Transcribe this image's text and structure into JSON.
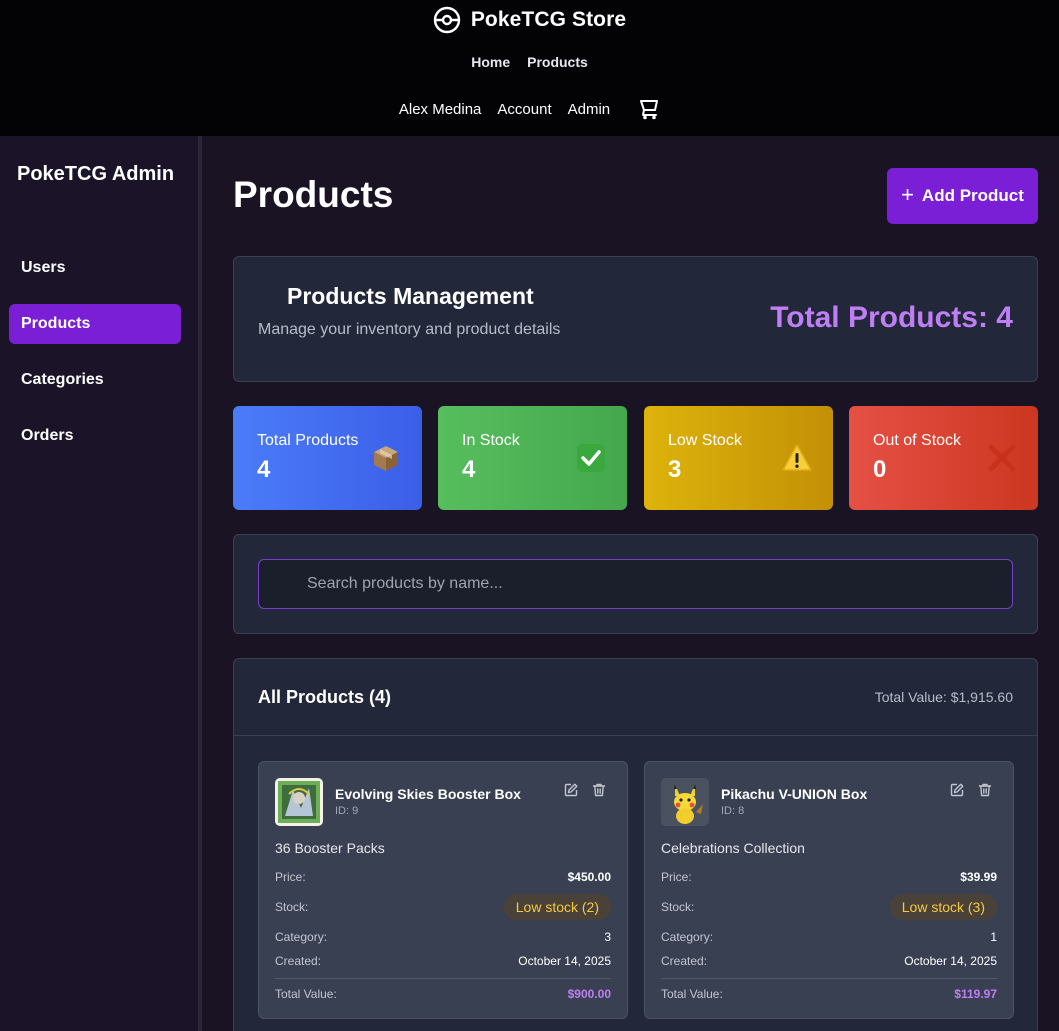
{
  "header": {
    "brand": "PokeTCG Store",
    "nav_primary": [
      "Home",
      "Products"
    ],
    "user_name": "Alex Medina",
    "account": "Account",
    "admin": "Admin"
  },
  "sidebar": {
    "title": "PokeTCG Admin",
    "items": [
      {
        "label": "Users",
        "active": false
      },
      {
        "label": "Products",
        "active": true
      },
      {
        "label": "Categories",
        "active": false
      },
      {
        "label": "Orders",
        "active": false
      }
    ]
  },
  "page": {
    "title": "Products",
    "add_button": "Add Product"
  },
  "management": {
    "title": "Products Management",
    "subtitle": "Manage your inventory and product details",
    "total": "Total Products: 4"
  },
  "stats": [
    {
      "label": "Total Products",
      "value": "4",
      "icon": "package-icon"
    },
    {
      "label": "In Stock",
      "value": "4",
      "icon": "check-icon"
    },
    {
      "label": "Low Stock",
      "value": "3",
      "icon": "warning-icon"
    },
    {
      "label": "Out of Stock",
      "value": "0",
      "icon": "cross-icon"
    }
  ],
  "search": {
    "placeholder": "Search products by name...",
    "value": ""
  },
  "list": {
    "title": "All Products (4)",
    "total_value": "Total Value: $1,915.60"
  },
  "products": [
    {
      "name": "Evolving Skies Booster Box",
      "id": "ID: 9",
      "description": "36 Booster Packs",
      "price_label": "Price:",
      "price": "$450.00",
      "stock_label": "Stock:",
      "stock": "Low stock (2)",
      "category_label": "Category:",
      "category": "3",
      "created_label": "Created:",
      "created": "October 14, 2025",
      "total_label": "Total Value:",
      "total": "$900.00"
    },
    {
      "name": "Pikachu V-UNION Box",
      "id": "ID: 8",
      "description": "Celebrations Collection",
      "price_label": "Price:",
      "price": "$39.99",
      "stock_label": "Stock:",
      "stock": "Low stock (3)",
      "category_label": "Category:",
      "category": "1",
      "created_label": "Created:",
      "created": "October 14, 2025",
      "total_label": "Total Value:",
      "total": "$119.97"
    }
  ],
  "colors": {
    "accent": "#7a1fd6",
    "accent_text": "#c07ef5",
    "badge_text": "#f6c945"
  }
}
